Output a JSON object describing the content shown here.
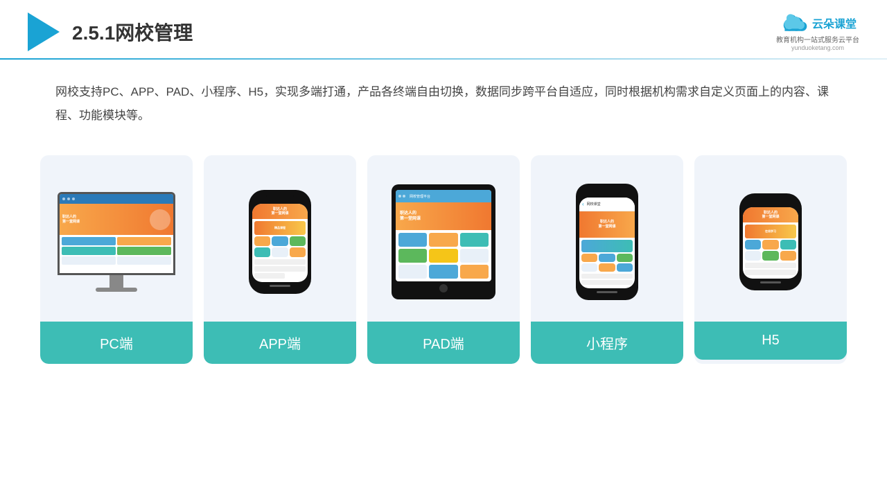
{
  "header": {
    "title": "2.5.1网校管理",
    "brand_name": "云朵课堂",
    "brand_url": "yunduoketang.com",
    "brand_slogan": "教育机构一站\n式服务云平台"
  },
  "description": "网校支持PC、APP、PAD、小程序、H5，实现多端打通，产品各终端自由切换，数据同步跨平台自适应，同时根据机构需求自定义页面上的内容、课程、功能模块等。",
  "cards": [
    {
      "id": "pc",
      "label": "PC端"
    },
    {
      "id": "app",
      "label": "APP端"
    },
    {
      "id": "pad",
      "label": "PAD端"
    },
    {
      "id": "miniprogram",
      "label": "小程序"
    },
    {
      "id": "h5",
      "label": "H5"
    }
  ],
  "colors": {
    "teal": "#3dbdb5",
    "blue": "#1aa3d4",
    "accent": "#f8a84b"
  }
}
